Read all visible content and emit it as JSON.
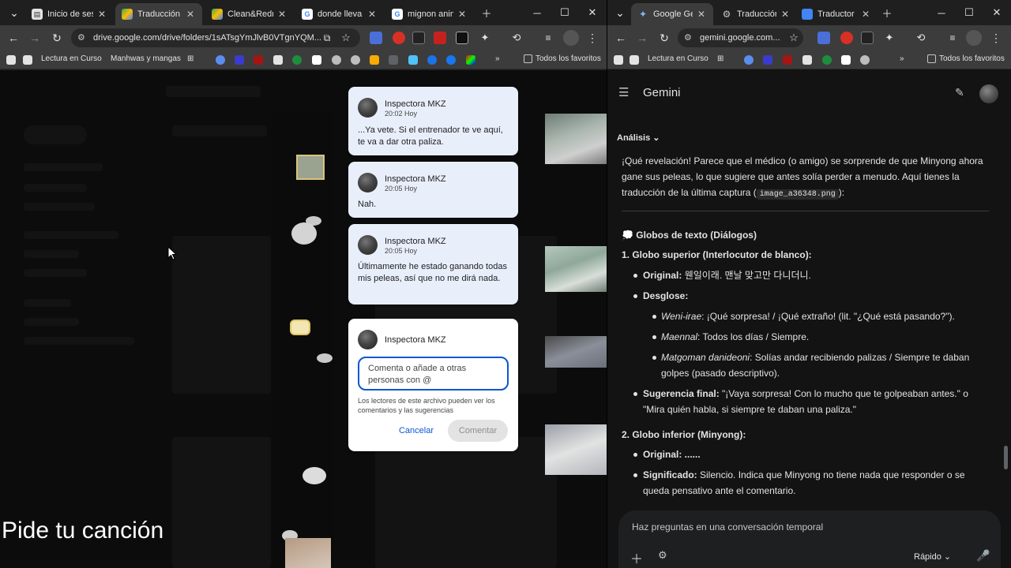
{
  "left_window": {
    "tabs": [
      {
        "title": "Inicio de sesión",
        "favicon": "generic-page-icon",
        "active": false
      },
      {
        "title": "Traducción - Google Drive",
        "favicon": "drive-icon",
        "active": true
      },
      {
        "title": "Clean&Redraw",
        "favicon": "drive-icon",
        "active": false
      },
      {
        "title": "donde lleva ac",
        "favicon": "google-icon",
        "active": false
      },
      {
        "title": "mignon anima",
        "favicon": "google-icon",
        "active": false
      }
    ],
    "url": "drive.google.com/drive/folders/1sATsgYmJlvB0VTgnYQM...",
    "bookmarks": {
      "folder1": "Lectura en Curso",
      "folder2": "Manhwas y mangas",
      "all": "Todos los favoritos"
    },
    "comments": [
      {
        "author": "Inspectora MKZ",
        "time": "20:02 Hoy",
        "text": "...Ya vete. Si el entrenador te ve aquí, te va a dar otra paliza."
      },
      {
        "author": "Inspectora MKZ",
        "time": "20:05 Hoy",
        "text": "Nah."
      },
      {
        "author": "Inspectora MKZ",
        "time": "20:05 Hoy",
        "text": "Últimamente he estado ganando todas mis peleas, así que no me dirá nada."
      }
    ],
    "reply": {
      "author": "Inspectora MKZ",
      "placeholder": "Comenta o añade a otras personas con @",
      "note": "Los lectores de este archivo pueden ver los comentarios y las sugerencias",
      "cancel": "Cancelar",
      "submit": "Comentar"
    },
    "overlay_text": "Pide tu canción"
  },
  "right_window": {
    "tabs": [
      {
        "title": "Google Gemini",
        "favicon": "gemini-icon",
        "active": true
      },
      {
        "title": "Traducción de",
        "favicon": "translate-icon",
        "active": false
      },
      {
        "title": "Traductor de",
        "favicon": "translator-icon",
        "active": false
      }
    ],
    "url": "gemini.google.com...",
    "bookmarks": {
      "folder1": "Lectura en Curso",
      "all": "Todos los favoritos"
    },
    "app_title": "Gemini",
    "analysis_label": "Análisis",
    "intro": "¡Qué revelación! Parece que el médico (o amigo) se sorprende de que Minyong ahora gane sus peleas, lo que sugiere que antes solía perder a menudo. Aquí tienes la traducción de la última captura (",
    "intro_file": "image_a36348.png",
    "intro_end": "):",
    "section_title": "Globos de texto (Diálogos)",
    "globe1_title": "1. Globo superior (Interlocutor de blanco):",
    "globe1_original_label": "Original:",
    "globe1_original": "웬일이래. 맨날 맞고만 다니더니.",
    "globe1_desglose_label": "Desglose:",
    "desglose": [
      {
        "term": "Weni-irae",
        "meaning": ": ¡Qué sorpresa! / ¡Qué extraño! (lit. \"¿Qué está pasando?\")."
      },
      {
        "term": "Maennal",
        "meaning": ": Todos los días / Siempre."
      },
      {
        "term": "Matgoman danideoni",
        "meaning": ": Solías andar recibiendo palizas / Siempre te daban golpes (pasado descriptivo)."
      }
    ],
    "globe1_suggest_label": "Sugerencia final:",
    "globe1_suggest": " \"¡Vaya sorpresa! Con lo mucho que te golpeaban antes.\" o \"Mira quién habla, si siempre te daban una paliza.\"",
    "globe2_title": "2. Globo inferior (Minyong):",
    "globe2_original_label": "Original:",
    "globe2_original": " ......",
    "globe2_meaning_label": "Significado:",
    "globe2_meaning": " Silencio. Indica que Minyong no tiene nada que responder o se queda pensativo ante el comentario.",
    "input_placeholder": "Haz preguntas en una conversación temporal",
    "mode_label": "Rápido"
  },
  "colors": {
    "accent_blue": "#0b57d0",
    "comment_bg": "#e9eefb",
    "gemini_bg": "#131314"
  }
}
